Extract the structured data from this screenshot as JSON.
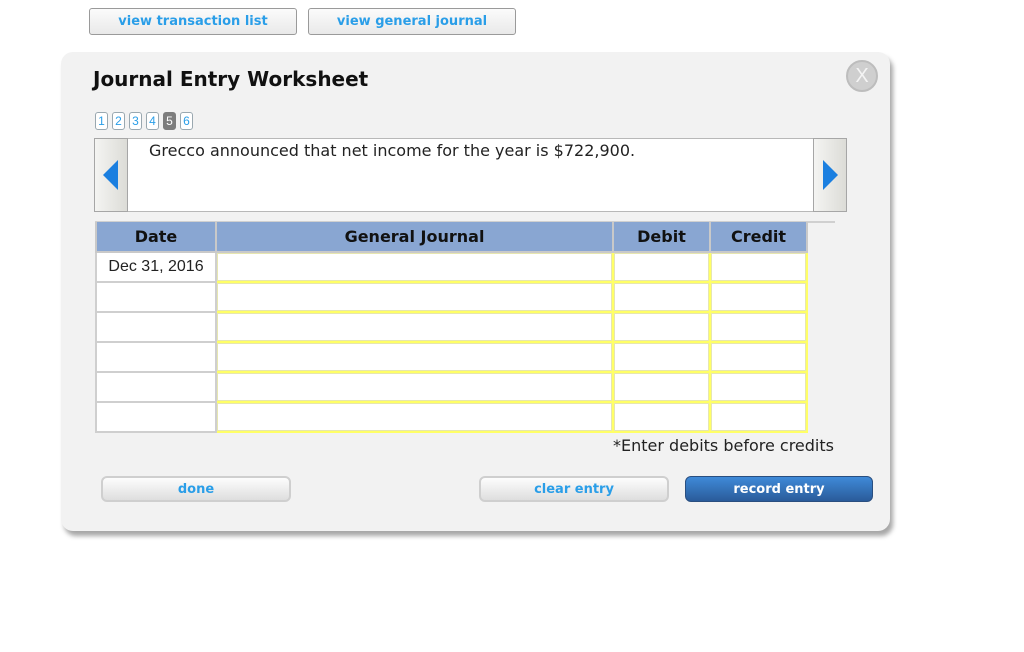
{
  "top_nav": {
    "view_transaction_list": "view transaction list",
    "view_general_journal": "view general journal"
  },
  "worksheet": {
    "title": "Journal Entry Worksheet",
    "close_label": "X",
    "pages": [
      "1",
      "2",
      "3",
      "4",
      "5",
      "6"
    ],
    "active_page": "5",
    "description": "Grecco announced that net income for the year is $722,900.",
    "colors": {
      "accent": "#2a9ee8",
      "header_bg": "#89a6d2",
      "input_border": "#ffff66",
      "record_button": "#2f6bb5"
    }
  },
  "table": {
    "headers": [
      "Date",
      "General Journal",
      "Debit",
      "Credit"
    ],
    "rows": [
      {
        "date": "Dec 31, 2016",
        "account": "",
        "debit": "",
        "credit": ""
      },
      {
        "date": "",
        "account": "",
        "debit": "",
        "credit": ""
      },
      {
        "date": "",
        "account": "",
        "debit": "",
        "credit": ""
      },
      {
        "date": "",
        "account": "",
        "debit": "",
        "credit": ""
      },
      {
        "date": "",
        "account": "",
        "debit": "",
        "credit": ""
      },
      {
        "date": "",
        "account": "",
        "debit": "",
        "credit": ""
      }
    ]
  },
  "note": "*Enter debits before credits",
  "buttons": {
    "done": "done",
    "clear_entry": "clear entry",
    "record_entry": "record entry"
  }
}
